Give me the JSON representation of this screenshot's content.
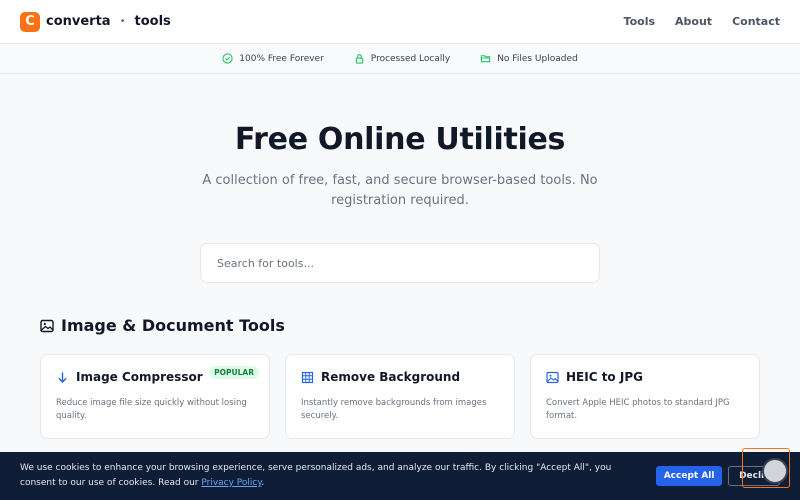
{
  "header": {
    "logo_left": "converta",
    "logo_dot": "•",
    "logo_right": "tools",
    "logo_mark": "C",
    "nav": [
      "Tools",
      "About",
      "Contact"
    ]
  },
  "trust": [
    {
      "icon": "check-circle-icon",
      "label": "100% Free Forever"
    },
    {
      "icon": "lock-icon",
      "label": "Processed Locally"
    },
    {
      "icon": "folder-icon",
      "label": "No Files Uploaded"
    }
  ],
  "hero": {
    "title": "Free Online Utilities",
    "subtitle": "A collection of free, fast, and secure browser-based tools. No registration required."
  },
  "search": {
    "placeholder": "Search for tools..."
  },
  "section": {
    "title": "Image & Document Tools",
    "icon": "image-icon"
  },
  "cards": [
    {
      "icon": "arrow-down-icon",
      "title": "Image Compressor",
      "badge": "POPULAR",
      "desc": "Reduce image file size quickly without losing quality."
    },
    {
      "icon": "grid-icon",
      "title": "Remove Background",
      "desc": "Instantly remove backgrounds from images securely."
    },
    {
      "icon": "image-icon",
      "title": "HEIC to JPG",
      "desc": "Convert Apple HEIC photos to standard JPG format."
    }
  ],
  "cookie": {
    "text": "We use cookies to enhance your browsing experience, serve personalized ads, and analyze our traffic. By clicking \"Accept All\", you consent to our use of cookies. Read our ",
    "link": "Privacy Policy",
    "end": ".",
    "accept": "Accept All",
    "decline": "Decli"
  },
  "colors": {
    "brand": "#f97316",
    "accent": "#2563eb",
    "banner": "#0f1e36",
    "badge_bg": "#dcfce7"
  }
}
